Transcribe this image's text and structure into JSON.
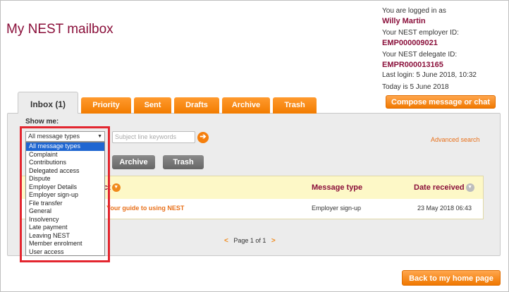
{
  "page": {
    "title": "My NEST mailbox"
  },
  "account": {
    "logged_in_label": "You are logged in as",
    "user_name": "Willy Martin",
    "employer_id_label": "Your NEST employer ID:",
    "employer_id": "EMP000009021",
    "delegate_id_label": "Your NEST delegate ID:",
    "delegate_id": "EMPR000013165",
    "last_login": "Last login: 5 June 2018, 10:32",
    "today": "Today is 5 June 2018"
  },
  "actions": {
    "compose": "Compose message or chat",
    "home": "Back to my home page"
  },
  "tabs": [
    {
      "label": "Inbox (1)",
      "active": true
    },
    {
      "label": "Priority"
    },
    {
      "label": "Sent"
    },
    {
      "label": "Drafts"
    },
    {
      "label": "Archive"
    },
    {
      "label": "Trash"
    }
  ],
  "filter": {
    "show_me_label": "Show me:",
    "selected": "All message types",
    "keyword_placeholder": "Subject line keywords",
    "go_icon": "arrow-right-icon",
    "advanced_search": "Advanced search",
    "options": [
      "All message types",
      "Complaint",
      "Contributions",
      "Delegated access",
      "Dispute",
      "Employer Details",
      "Employer sign-up",
      "File transfer",
      "General",
      "Insolvency",
      "Late payment",
      "Leaving NEST",
      "Member enrolment",
      "User access"
    ]
  },
  "bulk": {
    "archive": "Archive",
    "trash": "Trash"
  },
  "table": {
    "headers": {
      "subject": "Subject",
      "type": "Message type",
      "date": "Date received"
    },
    "rows": [
      {
        "subject": "Your guide to using NEST",
        "type": "Employer sign-up",
        "date": "23 May 2018 06:43"
      }
    ]
  },
  "pager": {
    "prev": "<",
    "text": "Page 1 of 1",
    "next": ">"
  },
  "colors": {
    "brand": "#8a0f3a",
    "accent": "#f07800",
    "highlight": "#e3262f",
    "selected": "#1f66d1"
  }
}
